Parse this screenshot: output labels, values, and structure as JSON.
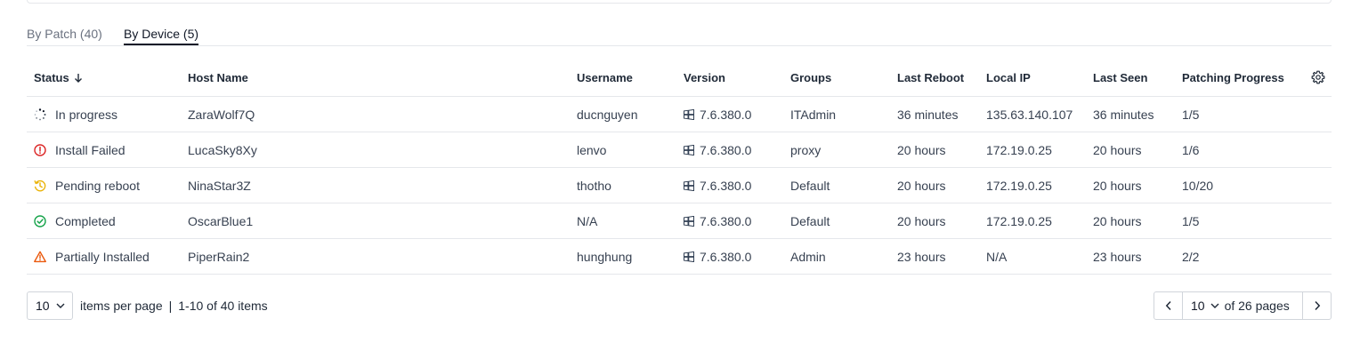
{
  "tabs": [
    {
      "label": "By Patch (40)"
    },
    {
      "label": "By Device (5)"
    }
  ],
  "table": {
    "columns": [
      "Status",
      "Host Name",
      "Username",
      "Version",
      "Groups",
      "Last Reboot",
      "Local IP",
      "Last Seen",
      "Patching Progress"
    ],
    "rows": [
      {
        "status": "In progress",
        "status_icon": "spinner-icon",
        "host": "ZaraWolf7Q",
        "user": "ducnguyen",
        "version": "7.6.380.0",
        "groups": "ITAdmin",
        "reboot": "36 minutes",
        "ip": "135.63.140.107",
        "seen": "36 minutes",
        "progress": "1/5"
      },
      {
        "status": "Install Failed",
        "status_icon": "error-circle-icon",
        "host": "LucaSky8Xy",
        "user": "lenvo",
        "version": "7.6.380.0",
        "groups": "proxy",
        "reboot": "20 hours",
        "ip": "172.19.0.25",
        "seen": "20 hours",
        "progress": "1/6"
      },
      {
        "status": "Pending reboot",
        "status_icon": "history-icon",
        "host": "NinaStar3Z",
        "user": "thotho",
        "version": "7.6.380.0",
        "groups": "Default",
        "reboot": "20 hours",
        "ip": "172.19.0.25",
        "seen": "20 hours",
        "progress": "10/20"
      },
      {
        "status": "Completed",
        "status_icon": "check-circle-icon",
        "host": "OscarBlue1",
        "user": "N/A",
        "version": "7.6.380.0",
        "groups": "Default",
        "reboot": "20 hours",
        "ip": "172.19.0.25",
        "seen": "20 hours",
        "progress": "1/5"
      },
      {
        "status": "Partially Installed",
        "status_icon": "warning-triangle-icon",
        "host": "PiperRain2",
        "user": "hunghung",
        "version": "7.6.380.0",
        "groups": "Admin",
        "reboot": "23 hours",
        "ip": "N/A",
        "seen": "23 hours",
        "progress": "2/2"
      }
    ]
  },
  "pagination": {
    "page_size": "10",
    "per_page_label": "items per page",
    "separator": "|",
    "range_label": "1-10 of 40 items",
    "current_page": "10",
    "of_pages_label": "of 26 pages"
  },
  "colors": {
    "error": "#dc2626",
    "pending": "#eab308",
    "success": "#16a34a",
    "warning": "#ea580c",
    "windows": "#334155"
  }
}
